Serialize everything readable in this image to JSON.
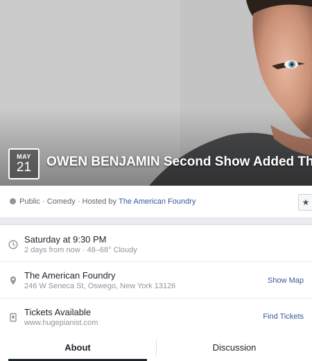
{
  "event": {
    "date_month": "MAY",
    "date_day": "21",
    "title": "OWEN BENJAMIN Second Show Added This S"
  },
  "meta": {
    "privacy": "Public",
    "category": "Comedy",
    "hosted_prefix": "Hosted by",
    "host": "The American Foundry",
    "separator": " · "
  },
  "details": {
    "time": {
      "title": "Saturday at 9:30 PM",
      "sub": "2 days from now · 48–68° Cloudy"
    },
    "location": {
      "title": "The American Foundry",
      "sub": "246 W Seneca St, Oswego, New York 13126",
      "action": "Show Map"
    },
    "tickets": {
      "title": "Tickets Available",
      "sub": "www.hugepianist.com",
      "action": "Find Tickets"
    }
  },
  "tabs": {
    "about": "About",
    "discussion": "Discussion"
  },
  "icons": {
    "privacy": "globe-icon",
    "time": "clock-icon",
    "location": "map-pin-icon",
    "tickets": "ticket-icon",
    "star": "star-icon"
  },
  "colors": {
    "link": "#365899",
    "muted": "#90949c",
    "text": "#1d2129"
  }
}
